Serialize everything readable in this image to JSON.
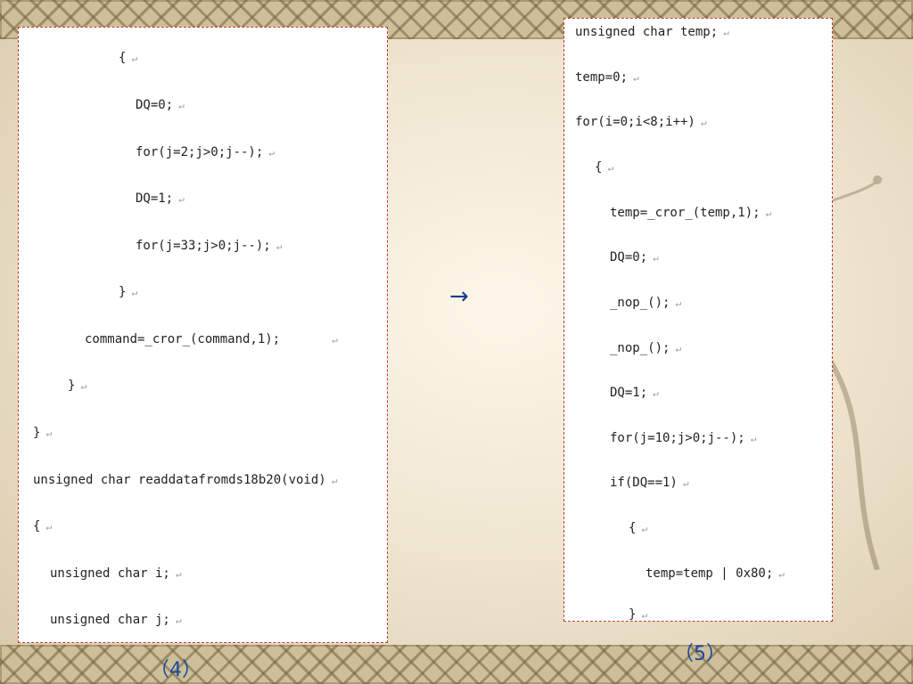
{
  "slide": {
    "left_block": {
      "lines": [
        "{",
        "DQ=0;",
        "for(j=2;j>0;j--);",
        "DQ=1;",
        "for(j=33;j>0;j--);",
        "}",
        "command=_cror_(command,1);",
        "}",
        "}",
        "unsigned char readdatafromds18b20(void)",
        "{",
        "unsigned char i;",
        "unsigned char j;"
      ],
      "caption": "（4）"
    },
    "arrow": "→",
    "right_block": {
      "lines": [
        "unsigned char temp;",
        "temp=0;",
        "for(i=0;i<8;i++)",
        "{",
        "temp=_cror_(temp,1);",
        "DQ=0;",
        "_nop_();",
        "_nop_();",
        "DQ=1;",
        "for(j=10;j>0;j--);",
        "if(DQ==1)",
        "{",
        "temp=temp | 0x80;",
        "}"
      ],
      "caption": "（5）"
    },
    "return_mark": "↵"
  }
}
